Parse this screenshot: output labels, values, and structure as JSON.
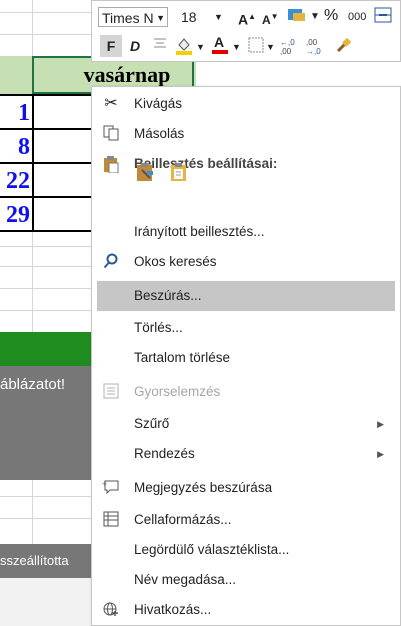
{
  "toolbar": {
    "font_name": "Times N",
    "font_size": "18",
    "grow_font": "A",
    "shrink_font": "A",
    "percent": "%",
    "thousands": "000",
    "bold": "F",
    "italic": "D",
    "dec_increase": "←,0 ,00",
    "dec_decrease": ",00 →,0"
  },
  "sheet": {
    "header": "vasárnap",
    "dates": [
      "1",
      "8",
      "22",
      "29"
    ],
    "gray_block_text": "áblázatot!",
    "gray_bar_text": "sszeállította"
  },
  "menu": {
    "items": [
      {
        "label": "Kivágás",
        "icon": "scissors-icon"
      },
      {
        "label": "Másolás",
        "icon": "copy-icon"
      },
      {
        "label": "Beillesztés beállításai:",
        "icon": "paste-icon"
      },
      {
        "label": "Irányított beillesztés...",
        "icon": ""
      },
      {
        "label": "Okos keresés",
        "icon": "search-icon"
      },
      {
        "label": "Beszúrás...",
        "icon": ""
      },
      {
        "label": "Törlés...",
        "icon": ""
      },
      {
        "label": "Tartalom törlése",
        "icon": ""
      },
      {
        "label": "Gyorselemzés",
        "icon": "quick-analysis-icon"
      },
      {
        "label": "Szűrő",
        "icon": ""
      },
      {
        "label": "Rendezés",
        "icon": ""
      },
      {
        "label": "Megjegyzés beszúrása",
        "icon": "comment-icon"
      },
      {
        "label": "Cellaformázás...",
        "icon": "format-cells-icon"
      },
      {
        "label": "Legördülő választéklista...",
        "icon": ""
      },
      {
        "label": "Név megadása...",
        "icon": ""
      },
      {
        "label": "Hivatkozás...",
        "icon": "hyperlink-icon"
      }
    ]
  },
  "colors": {
    "header_green": "#c6e0b4",
    "date_blue": "#1010ee",
    "green_bar": "#1e8c1e",
    "highlight": "#c6c6c6",
    "font_red": "#e00000",
    "fill_yellow": "#f5d000"
  }
}
